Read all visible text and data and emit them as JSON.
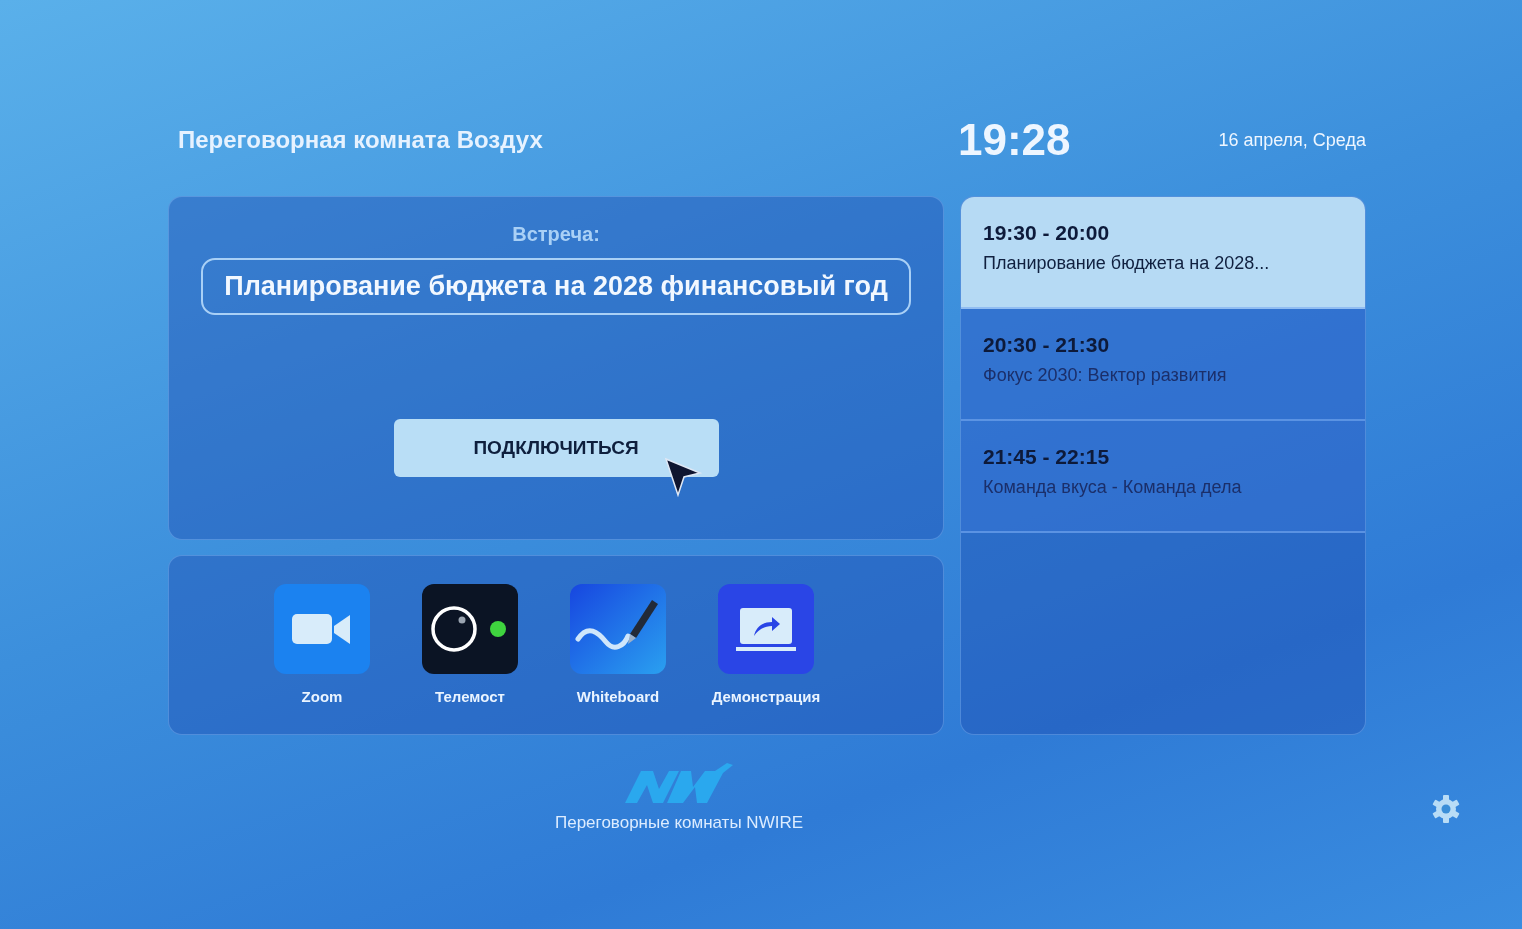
{
  "header": {
    "room": "Переговорная комната Воздух",
    "time": "19:28",
    "date": "16 апреля, Среда"
  },
  "meeting": {
    "label": "Встреча:",
    "title": "Планирование бюджета на 2028 финансовый год",
    "button": "ПОДКЛЮЧИТЬСЯ"
  },
  "apps": [
    {
      "kind": "zoom",
      "label": "Zoom"
    },
    {
      "kind": "telemost",
      "label": "Телемост"
    },
    {
      "kind": "whiteboard",
      "label": "Whiteboard"
    },
    {
      "kind": "share",
      "label": "Демонстрация"
    }
  ],
  "schedule": [
    {
      "time": "19:30 - 20:00",
      "title": "Планирование бюджета на 2028...",
      "selected": true
    },
    {
      "time": "20:30 - 21:30",
      "title": "Фокус 2030: Вектор развития",
      "selected": false
    },
    {
      "time": "21:45 - 22:15",
      "title": "Команда вкуса - Команда дела",
      "selected": false
    }
  ],
  "footer": {
    "caption": "Переговорные комнаты NWIRE"
  }
}
